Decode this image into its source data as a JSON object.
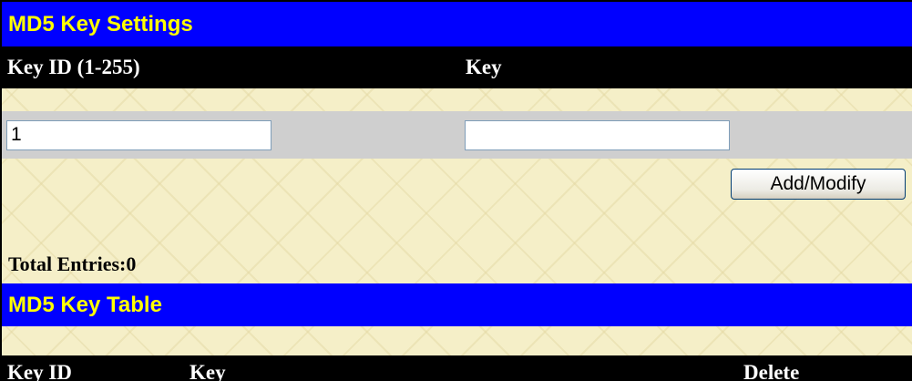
{
  "settings": {
    "title": "MD5 Key Settings",
    "col_key_id": "Key ID (1-255)",
    "col_key": "Key",
    "key_id_value": "1",
    "key_value": "",
    "add_modify_label": "Add/Modify"
  },
  "total_entries_label": "Total Entries:0",
  "table": {
    "title": "MD5 Key Table",
    "columns": [
      "Key ID",
      "Key",
      "Delete"
    ],
    "rows": []
  },
  "colors": {
    "header_bg": "#0000ff",
    "header_text": "#ffff00",
    "column_header_bg": "#000000",
    "column_header_text": "#ffffff",
    "input_row_bg": "#cfcfcf",
    "page_bg": "#f5efc8"
  }
}
